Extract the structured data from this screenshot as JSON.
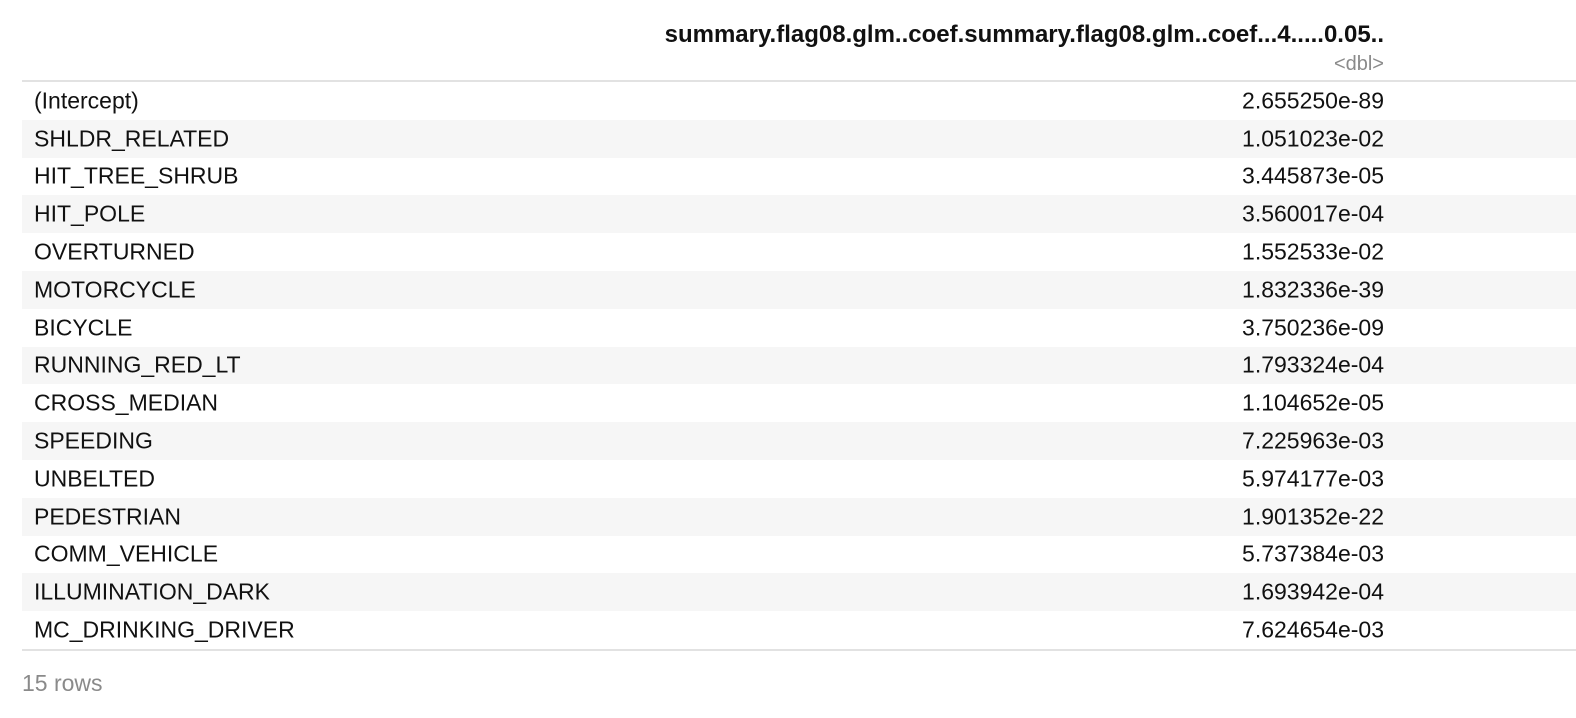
{
  "table": {
    "column_header": "summary.flag08.glm..coef.summary.flag08.glm..coef...4.....0.05..",
    "column_type": "<dbl>",
    "rows": [
      {
        "name": "(Intercept)",
        "value": "2.655250e-89"
      },
      {
        "name": "SHLDR_RELATED",
        "value": "1.051023e-02"
      },
      {
        "name": "HIT_TREE_SHRUB",
        "value": "3.445873e-05"
      },
      {
        "name": "HIT_POLE",
        "value": "3.560017e-04"
      },
      {
        "name": "OVERTURNED",
        "value": "1.552533e-02"
      },
      {
        "name": "MOTORCYCLE",
        "value": "1.832336e-39"
      },
      {
        "name": "BICYCLE",
        "value": "3.750236e-09"
      },
      {
        "name": "RUNNING_RED_LT",
        "value": "1.793324e-04"
      },
      {
        "name": "CROSS_MEDIAN",
        "value": "1.104652e-05"
      },
      {
        "name": "SPEEDING",
        "value": "7.225963e-03"
      },
      {
        "name": "UNBELTED",
        "value": "5.974177e-03"
      },
      {
        "name": "PEDESTRIAN",
        "value": "1.901352e-22"
      },
      {
        "name": "COMM_VEHICLE",
        "value": "5.737384e-03"
      },
      {
        "name": "ILLUMINATION_DARK",
        "value": "1.693942e-04"
      },
      {
        "name": "MC_DRINKING_DRIVER",
        "value": "7.624654e-03"
      }
    ],
    "footer": "15 rows"
  }
}
